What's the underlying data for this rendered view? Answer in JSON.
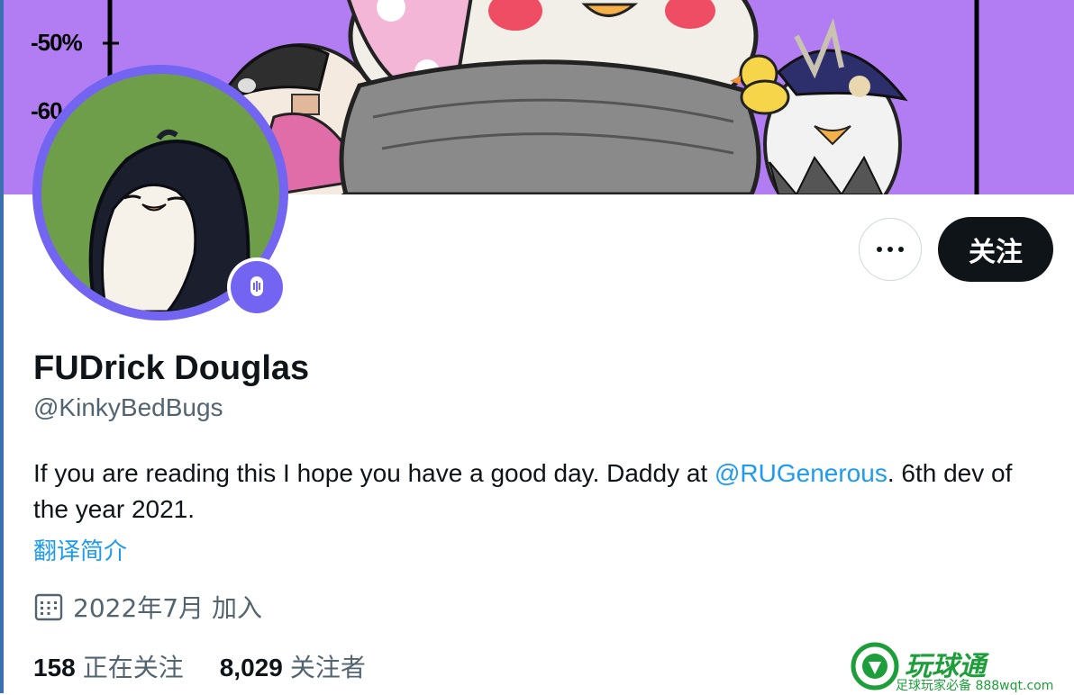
{
  "banner": {
    "tick_labels": [
      "-50%",
      "-60"
    ]
  },
  "actions": {
    "follow_label": "关注"
  },
  "profile": {
    "display_name": "FUDrick Douglas",
    "handle": "@KinkyBedBugs",
    "bio_before": "If you are reading this I hope you have a good day. Daddy at ",
    "bio_mention": "@RUGenerous",
    "bio_after": ". 6th dev of the year 2021.",
    "translate_label": "翻译简介",
    "joined_text": "2022年7月 加入",
    "following_count": "158",
    "following_label": "正在关注",
    "followers_count": "8,029",
    "followers_label": "关注者"
  },
  "watermark": {
    "title": "玩球通",
    "subtitle": "足球玩家必备 888wqt.com"
  },
  "colors": {
    "accent": "#1d9bf0",
    "banner_bg": "#b27df3",
    "avatar_ring": "#7364f2",
    "avatar_bg": "#6f9e4b"
  }
}
